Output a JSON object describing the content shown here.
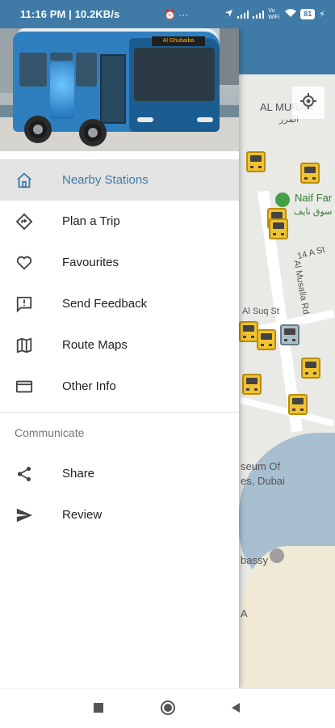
{
  "status_bar": {
    "time_and_speed": "11:16 PM | 10.2KB/s",
    "extra": "⏰ ···",
    "net_label": "Vo WiFi",
    "battery": "81"
  },
  "map": {
    "labels": {
      "area_name": "AL MURAR",
      "area_name_ar": "المرر",
      "place": "Naif Far",
      "place_ar": "سوق نايف",
      "street_14": "14 A St",
      "street_musalla": "Al Musalla Rd",
      "street_suq": "Al Suq St",
      "museum": "seum Of",
      "museum_2": "es, Dubai",
      "embassy": "bassy",
      "letter": "A"
    }
  },
  "drawer": {
    "header_image": "Volvo city bus photo",
    "bus_sign": "Al Ghubaiba",
    "items": [
      {
        "label": "Nearby Stations",
        "icon": "home-icon",
        "active": true
      },
      {
        "label": "Plan a Trip",
        "icon": "directions-icon",
        "active": false
      },
      {
        "label": "Favourites",
        "icon": "heart-icon",
        "active": false
      },
      {
        "label": "Send Feedback",
        "icon": "feedback-icon",
        "active": false
      },
      {
        "label": "Route Maps",
        "icon": "map-icon",
        "active": false
      },
      {
        "label": "Other Info",
        "icon": "card-icon",
        "active": false
      }
    ],
    "section_title": "Communicate",
    "communicate_items": [
      {
        "label": "Share",
        "icon": "share-icon"
      },
      {
        "label": "Review",
        "icon": "send-icon"
      }
    ]
  },
  "nav_bar": {
    "buttons": [
      "recent-apps",
      "home",
      "back"
    ]
  },
  "colors": {
    "primary": "#3f7ba6",
    "active_bg": "#e3e3e3",
    "bus_marker": "#f1c232"
  }
}
